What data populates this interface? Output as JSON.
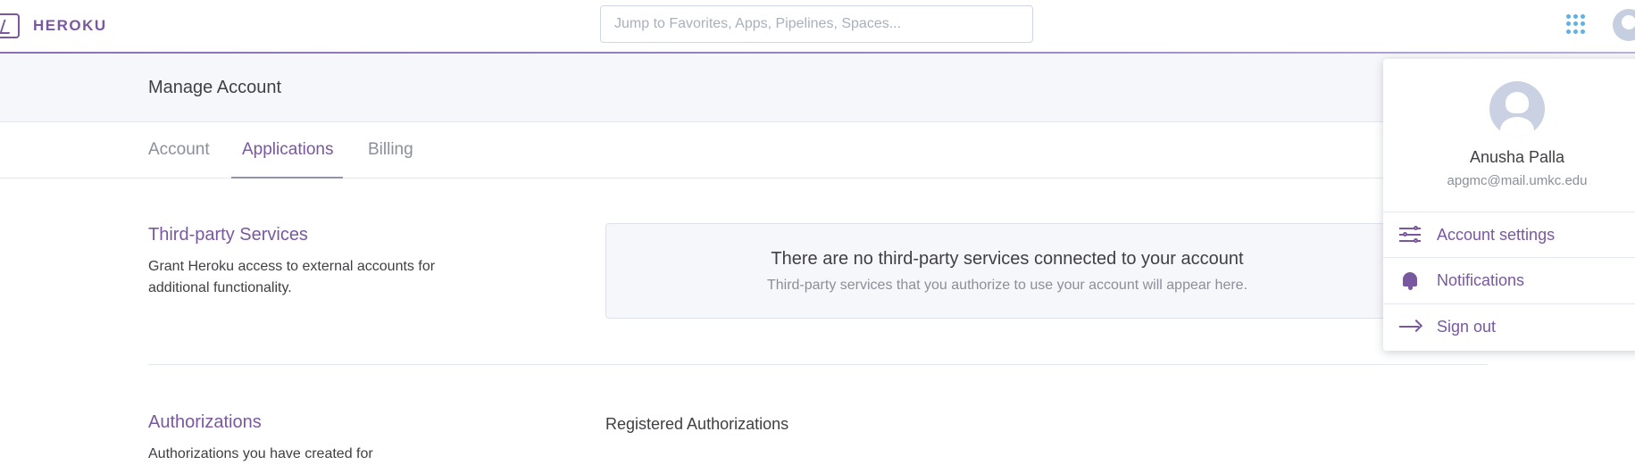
{
  "header": {
    "brand": "HEROKU",
    "search_placeholder": "Jump to Favorites, Apps, Pipelines, Spaces..."
  },
  "subheader": {
    "title": "Manage Account"
  },
  "tabs": [
    {
      "label": "Account",
      "active": false
    },
    {
      "label": "Applications",
      "active": true
    },
    {
      "label": "Billing",
      "active": false
    }
  ],
  "third_party": {
    "title": "Third-party Services",
    "description": "Grant Heroku access to external accounts for additional functionality.",
    "empty_title": "There are no third-party services connected to your account",
    "empty_subtitle": "Third-party services that you authorize to use your account will appear here."
  },
  "authorizations": {
    "title": "Authorizations",
    "description": "Authorizations you have created for",
    "registered_label": "Registered Authorizations"
  },
  "user_menu": {
    "name": "Anusha Palla",
    "email": "apgmc@mail.umkc.edu",
    "items": [
      {
        "label": "Account settings",
        "icon": "sliders-icon"
      },
      {
        "label": "Notifications",
        "icon": "bell-icon"
      },
      {
        "label": "Sign out",
        "icon": "arrow-right-icon"
      }
    ]
  },
  "colors": {
    "brand": "#79589f",
    "apps_grid": "#63b0e3",
    "muted_text": "#8a8f99"
  }
}
